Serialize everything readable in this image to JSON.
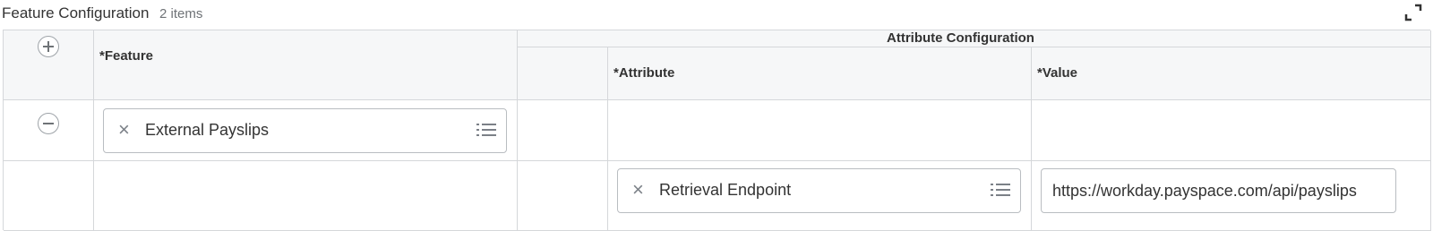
{
  "header": {
    "title": "Feature Configuration",
    "count": "2 items"
  },
  "columns": {
    "group_label": "Attribute Configuration",
    "feature": "*Feature",
    "attribute": "*Attribute",
    "value": "*Value"
  },
  "rows": [
    {
      "feature": "External Payslips"
    },
    {
      "attribute": "Retrieval Endpoint",
      "value": "https://workday.payspace.com/api/payslips"
    }
  ],
  "icons": {
    "expand": "expand-icon",
    "add": "add-row-icon",
    "remove": "remove-row-icon",
    "clear": "close-icon",
    "prompt": "list-icon"
  }
}
